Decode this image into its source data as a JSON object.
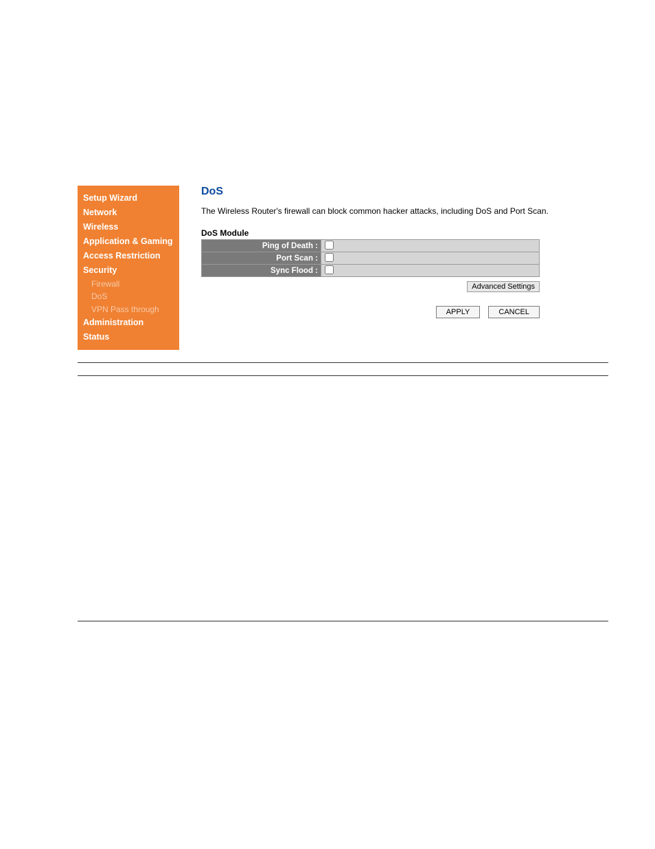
{
  "sidebar": {
    "items": [
      {
        "label": "Setup Wizard",
        "type": "item"
      },
      {
        "label": "Network",
        "type": "item"
      },
      {
        "label": "Wireless",
        "type": "item"
      },
      {
        "label": "Application & Gaming",
        "type": "item"
      },
      {
        "label": "Access Restriction",
        "type": "item"
      },
      {
        "label": "Security",
        "type": "item"
      },
      {
        "label": "Firewall",
        "type": "sub"
      },
      {
        "label": "DoS",
        "type": "sub"
      },
      {
        "label": "VPN Pass through",
        "type": "sub"
      },
      {
        "label": "Administration",
        "type": "item"
      },
      {
        "label": "Status",
        "type": "item"
      }
    ]
  },
  "main": {
    "title": "DoS",
    "description": "The Wireless Router's firewall can block common hacker attacks, including DoS and Port Scan.",
    "section_title": "DoS Module",
    "rows": [
      {
        "label": "Ping of Death :"
      },
      {
        "label": "Port Scan :"
      },
      {
        "label": "Sync Flood :"
      }
    ],
    "advanced_label": "Advanced Settings",
    "apply_label": "APPLY",
    "cancel_label": "CANCEL"
  }
}
